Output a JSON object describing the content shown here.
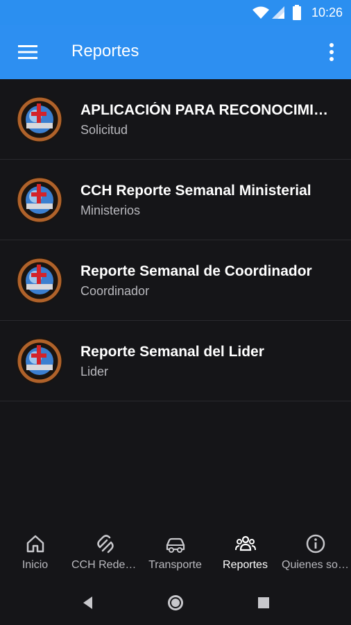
{
  "status_bar": {
    "time": "10:26",
    "icons": [
      "wifi-icon",
      "signal-icon",
      "battery-icon"
    ]
  },
  "app_bar": {
    "title": "Reportes",
    "menu_icon": "hamburger-menu-icon",
    "more_icon": "more-vert-icon"
  },
  "colors": {
    "app_bar": "#2d8ff1",
    "background": "#151518",
    "title_text": "#ffffff",
    "subtitle_text": "#b9b9be"
  },
  "reports": [
    {
      "title": "APLICACIÓN PARA RECONOCIMIENTO",
      "subtitle": "Solicitud",
      "icon": "cch-logo-icon"
    },
    {
      "title": "CCH Reporte Semanal Ministerial",
      "subtitle": "Ministerios",
      "icon": "cch-logo-icon"
    },
    {
      "title": "Reporte Semanal de Coordinador",
      "subtitle": "Coordinador",
      "icon": "cch-logo-icon"
    },
    {
      "title": "Reporte Semanal del Lider",
      "subtitle": "Lider",
      "icon": "cch-logo-icon"
    }
  ],
  "bottom_nav": {
    "active": "Reportes",
    "items": [
      {
        "label": "Inicio",
        "icon": "home-icon"
      },
      {
        "label": "CCH Redes Sociales",
        "icon": "network-icon"
      },
      {
        "label": "Transporte",
        "icon": "car-icon"
      },
      {
        "label": "Reportes",
        "icon": "people-icon"
      },
      {
        "label": "Quienes somos",
        "icon": "info-icon"
      }
    ]
  },
  "system_nav": [
    "back-icon",
    "home-circle-icon",
    "recents-icon"
  ]
}
